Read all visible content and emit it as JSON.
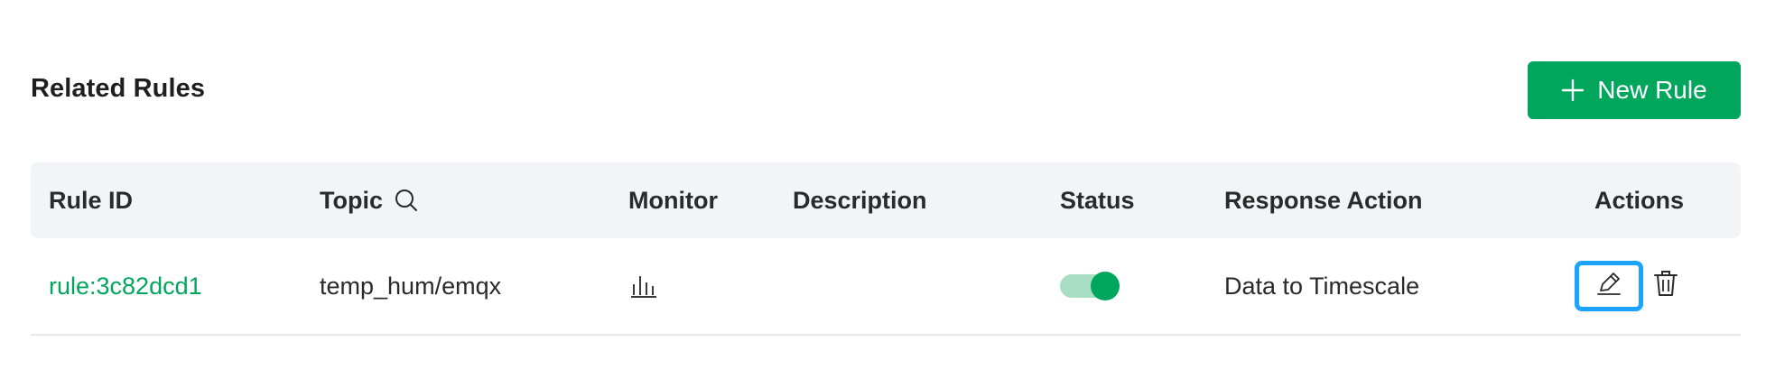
{
  "header": {
    "title": "Related Rules",
    "new_rule_label": "New Rule"
  },
  "table": {
    "columns": [
      "Rule ID",
      "Topic",
      "Monitor",
      "Description",
      "Status",
      "Response Action",
      "Actions"
    ],
    "rows": [
      {
        "rule_id": "rule:3c82dcd1",
        "topic": "temp_hum/emqx",
        "description": "",
        "status_enabled": true,
        "response_action": "Data to Timescale"
      }
    ]
  },
  "colors": {
    "primary_green": "#00a65c",
    "toggle_track": "#a8dfc4",
    "focus_blue": "#1aa3ff",
    "header_bg": "#f2f4f7"
  },
  "icons": {
    "new_rule": "plus-icon",
    "topic_search": "search-icon",
    "monitor": "bar-chart-icon",
    "edit": "pencil-icon",
    "delete": "trash-icon"
  }
}
